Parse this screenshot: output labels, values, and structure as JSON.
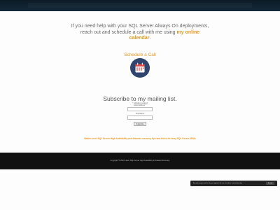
{
  "help": {
    "text": "If you need help with your SQL Server Always On deployments, reach out and schedule a call with me using",
    "link": "my online calendar"
  },
  "schedule_label": "Schedule a Call",
  "icons": {
    "calendar": "calendar-icon"
  },
  "subscribe": {
    "heading": "Subscribe to my mailing list.",
    "required_note": "* indicates required",
    "email_label": "Email Address *",
    "first_name_label": "First Name",
    "button": "Subscribe"
  },
  "tagline": "Master-level SQL Server High Availability and disaster recovery tips and tricks for busy SQL Server DBAs",
  "footer": {
    "copyright": "Copyright © 2023 Learn SQL Server High Availability & Disaster Recovery"
  },
  "cookie": {
    "text": "By continuing to use the site, you agree to the use of cookies. more information",
    "accept": "Accept"
  },
  "colors": {
    "accent": "#e8961e",
    "dark": "#111111",
    "icon_bg": "#2f4570",
    "icon_red": "#d84a4a"
  }
}
